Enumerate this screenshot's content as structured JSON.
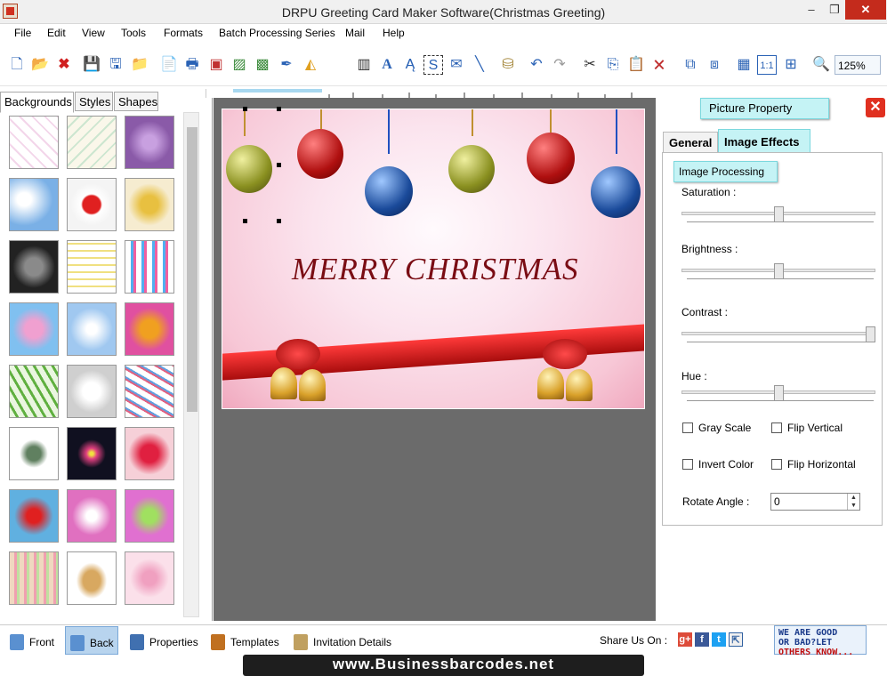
{
  "window": {
    "title": "DRPU Greeting Card Maker Software(Christmas Greeting)",
    "min_symbol": "–",
    "max_symbol": "❐",
    "close_symbol": "✕"
  },
  "menu": {
    "items": [
      "File",
      "Edit",
      "View",
      "Tools",
      "Formats",
      "Batch Processing Series",
      "Mail",
      "Help"
    ]
  },
  "toolbar": {
    "zoom_value": "125%",
    "icons": [
      "new-file-icon",
      "open-folder-icon",
      "close-doc-icon",
      "save-icon",
      "save-as-icon",
      "open-icon",
      "page-setup-icon",
      "print-icon",
      "print-preview-icon",
      "crop-image-icon",
      "add-image-icon",
      "pen-icon",
      "shape-icon",
      "barcode-icon",
      "text-icon",
      "text-style-icon",
      "signature-icon",
      "mail-icon",
      "line-icon",
      "database-icon",
      "undo-icon",
      "redo-icon",
      "cut-icon",
      "copy-icon",
      "paste-icon",
      "delete-icon",
      "bring-front-icon",
      "send-back-icon",
      "grid-icon",
      "actual-size-icon",
      "fit-icon",
      "zoom-icon"
    ]
  },
  "left_panel": {
    "tabs": [
      "Backgrounds",
      "Styles",
      "Shapes"
    ],
    "active_tab": "Backgrounds"
  },
  "card": {
    "greeting": "MERRY CHRISTMAS"
  },
  "right_panel": {
    "header": "Picture Property",
    "close_symbol": "✕",
    "tabs": [
      "General",
      "Image Effects"
    ],
    "active_tab": "Image Effects",
    "section": "Image Processing",
    "sliders": [
      {
        "label": "Saturation :",
        "level": 0.5
      },
      {
        "label": "Brightness :",
        "level": 0.5
      },
      {
        "label": "Contrast :",
        "level": 1.0
      },
      {
        "label": "Hue :",
        "level": 0.5
      }
    ],
    "checkboxes": [
      {
        "label": "Gray Scale",
        "checked": false
      },
      {
        "label": "Flip Vertical",
        "checked": false
      },
      {
        "label": "Invert Color",
        "checked": false
      },
      {
        "label": "Flip Horizontal",
        "checked": false
      }
    ],
    "rotate_label": "Rotate Angle :",
    "rotate_value": "0"
  },
  "bottom_bar": {
    "front": "Front",
    "back": "Back",
    "properties": "Properties",
    "templates": "Templates",
    "invitation": "Invitation Details",
    "share": "Share Us On :",
    "feedback_line1": "WE ARE GOOD",
    "feedback_line2": "OR BAD?LET",
    "feedback_line3": "OTHERS KNOW..."
  },
  "footer": {
    "url": "www.Businessbarcodes.net"
  },
  "colors": {
    "accent_cyan": "#c5f3f5",
    "card_text": "#7a0d14",
    "canvas_bg": "#6b6b6b"
  }
}
